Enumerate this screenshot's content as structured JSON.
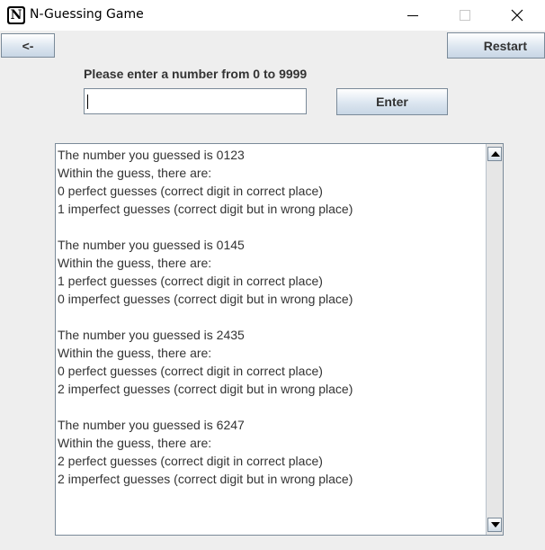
{
  "window": {
    "title": "N-Guessing Game",
    "icon": "N"
  },
  "toolbar": {
    "back_label": "<-",
    "restart_label": "Restart"
  },
  "input": {
    "prompt": "Please enter a number from 0 to 9999",
    "value": "",
    "enter_label": "Enter"
  },
  "output": {
    "lines": [
      "The number you guessed is 0123",
      "Within the guess, there are:",
      "0 perfect guesses (correct digit in correct place)",
      "1 imperfect guesses (correct digit but in wrong place)",
      "",
      "The number you guessed is 0145",
      "Within the guess, there are:",
      "1 perfect guesses (correct digit in correct place)",
      "0 imperfect guesses (correct digit but in wrong place)",
      "",
      "The number you guessed is 2435",
      "Within the guess, there are:",
      "0 perfect guesses (correct digit in correct place)",
      "2 imperfect guesses (correct digit but in wrong place)",
      "",
      "The number you guessed is 6247",
      "Within the guess, there are:",
      "2 perfect guesses (correct digit in correct place)",
      "2 imperfect guesses (correct digit but in wrong place)"
    ]
  }
}
